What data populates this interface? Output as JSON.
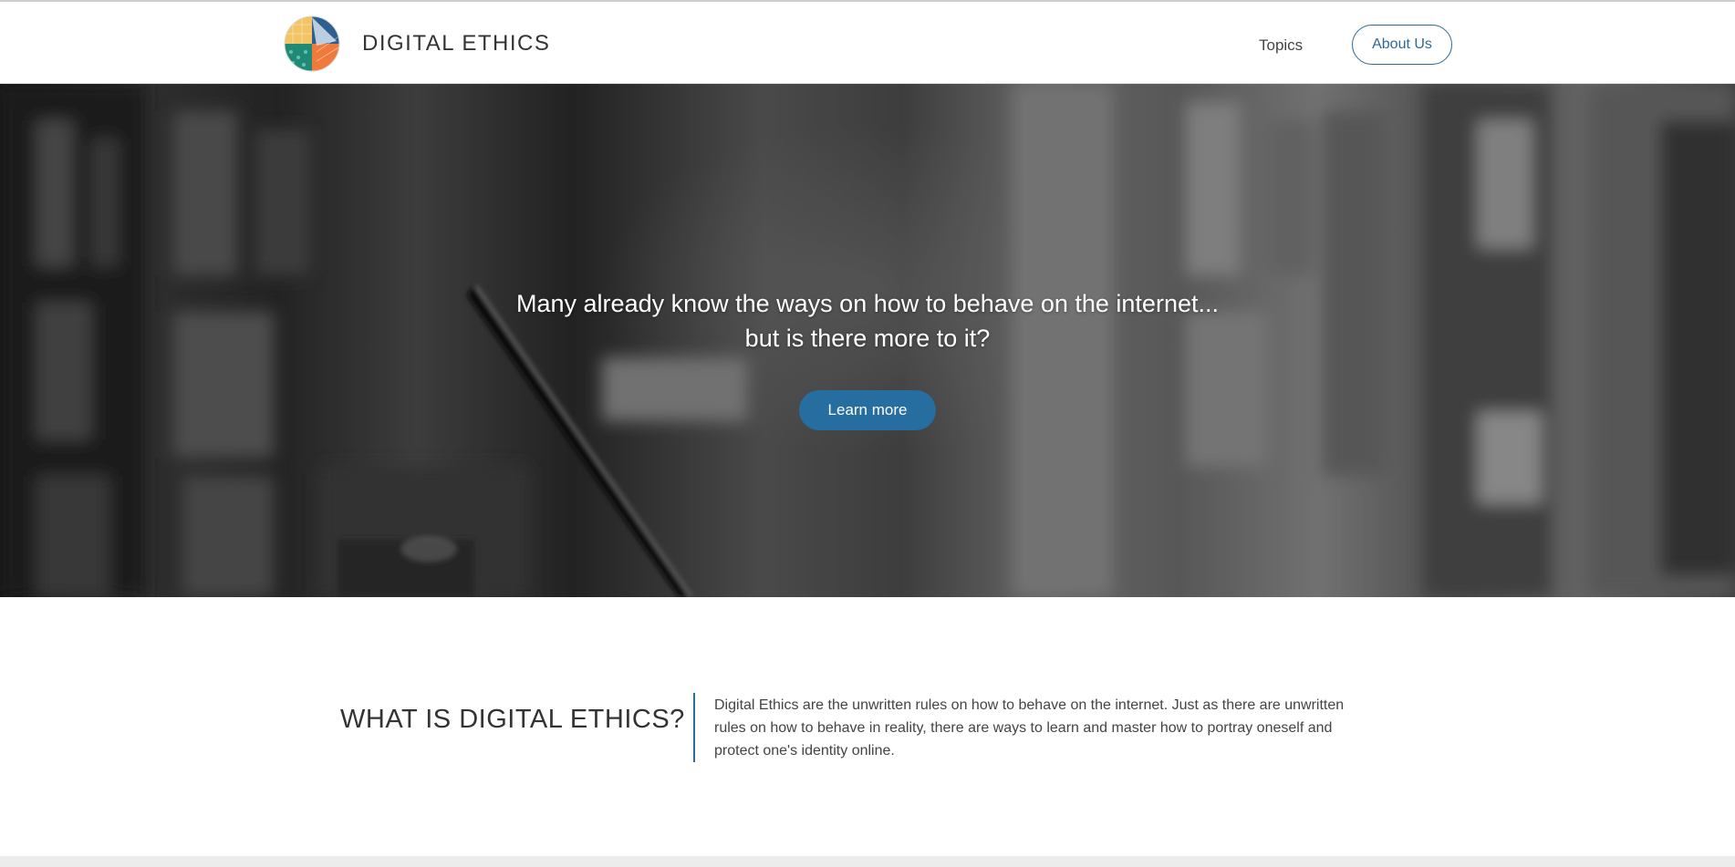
{
  "header": {
    "site_title": "DIGITAL ETHICS",
    "nav": {
      "topics_label": "Topics",
      "about_label": "About Us"
    }
  },
  "hero": {
    "headline_line1": "Many already know the ways on how to behave on the internet...",
    "headline_line2": "but is there more to it?",
    "cta_label": "Learn more"
  },
  "intro": {
    "heading": "WHAT IS DIGITAL ETHICS?",
    "body": "Digital Ethics are the unwritten rules on how to behave on the internet. Just as there are unwritten rules on how to behave in reality, there are ways to learn and master how to portray oneself and protect one's identity online."
  },
  "colors": {
    "accent": "#266da0",
    "logo_yellow": "#f2c464",
    "logo_teal": "#1f8a78",
    "logo_orange": "#f07a3c",
    "logo_blue": "#2f5f8e"
  },
  "icons": {
    "logo": "globe-logo-icon"
  }
}
